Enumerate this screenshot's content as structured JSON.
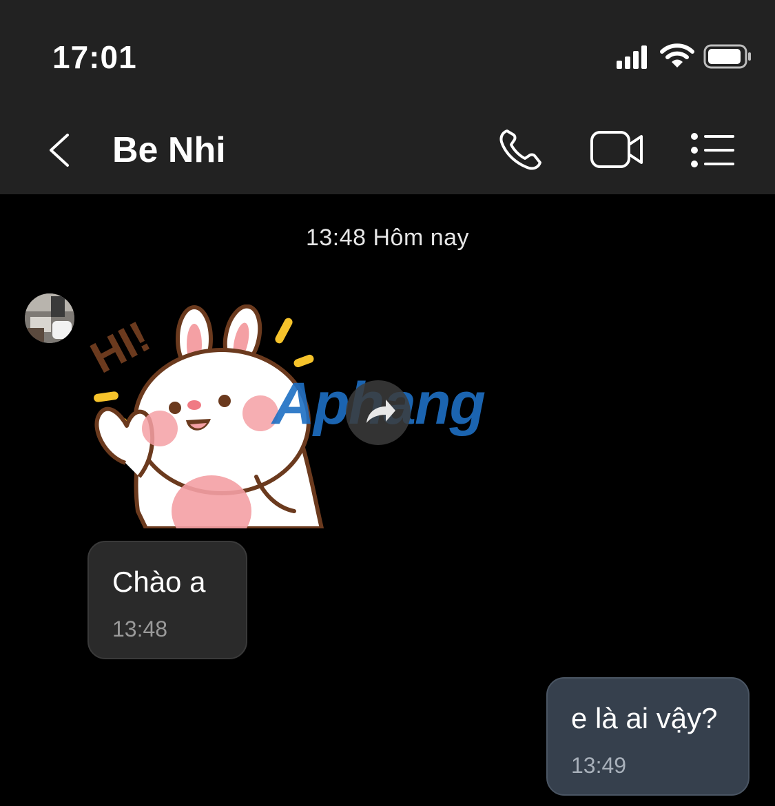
{
  "status_bar": {
    "time": "17:01",
    "signal_icon": "cellular-signal-icon",
    "wifi_icon": "wifi-icon",
    "battery_icon": "battery-icon",
    "battery_level": 0.85
  },
  "header": {
    "contact_name": "Be Nhi",
    "back_icon": "chevron-left-icon",
    "call_icon": "phone-icon",
    "video_icon": "video-camera-icon",
    "menu_icon": "list-menu-icon"
  },
  "conversation": {
    "date_separator": "13:48 Hôm nay",
    "messages": [
      {
        "direction": "incoming",
        "type": "sticker",
        "sticker_text": "HI!"
      },
      {
        "direction": "incoming",
        "type": "text",
        "text": "Chào a",
        "time": "13:48"
      },
      {
        "direction": "outgoing",
        "type": "text",
        "text": "e là ai vậy?",
        "time": "13:49"
      }
    ],
    "watermark": "Aphang",
    "forward_icon": "share-forward-icon"
  },
  "colors": {
    "bar_background": "#222222",
    "chat_background": "#000000",
    "incoming_bubble": "#2a2a2a",
    "outgoing_bubble": "#36404d"
  }
}
